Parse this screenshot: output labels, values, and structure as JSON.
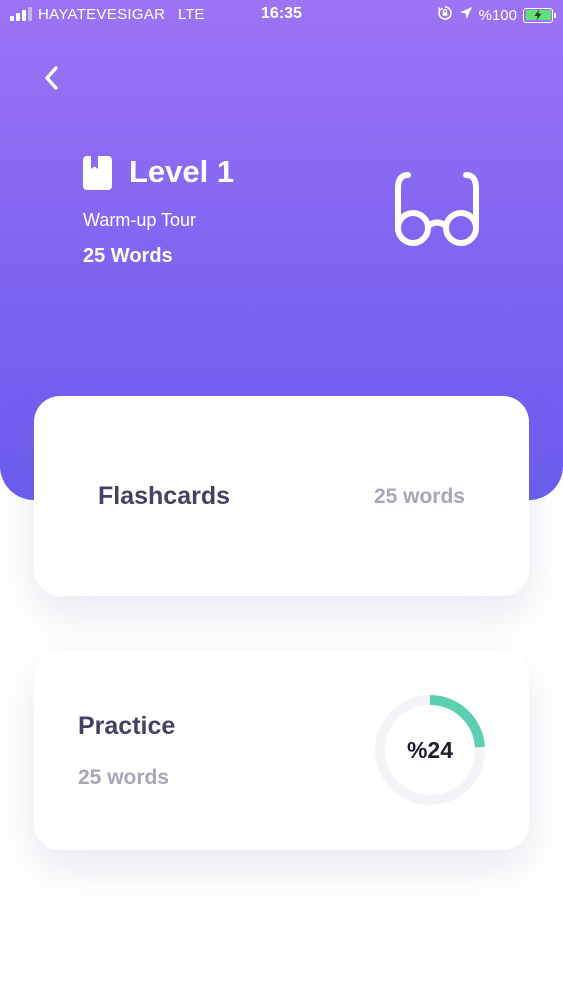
{
  "status_bar": {
    "carrier": "HAYATEVESIGAR",
    "network": "LTE",
    "time": "16:35",
    "battery_text": "%100",
    "battery_color": "#5ee27a"
  },
  "level": {
    "title": "Level 1",
    "subtitle": "Warm-up Tour",
    "count_label": "25 Words"
  },
  "flashcards": {
    "title": "Flashcards",
    "count_label": "25 words"
  },
  "practice": {
    "title": "Practice",
    "count_label": "25 words",
    "progress_label": "%24",
    "progress_fraction": 0.24,
    "progress_color": "#5ccfb0"
  },
  "colors": {
    "accent_top": "#9d74f4",
    "accent_bottom": "#6a5cf0",
    "title_text": "#414264",
    "muted_text": "#a7a8b6"
  },
  "icons": {
    "back": "chevron-left-icon",
    "level": "book-icon",
    "hero": "glasses-icon",
    "orientation": "orientation-lock-icon",
    "location": "location-arrow-icon",
    "charging": "bolt-icon"
  }
}
